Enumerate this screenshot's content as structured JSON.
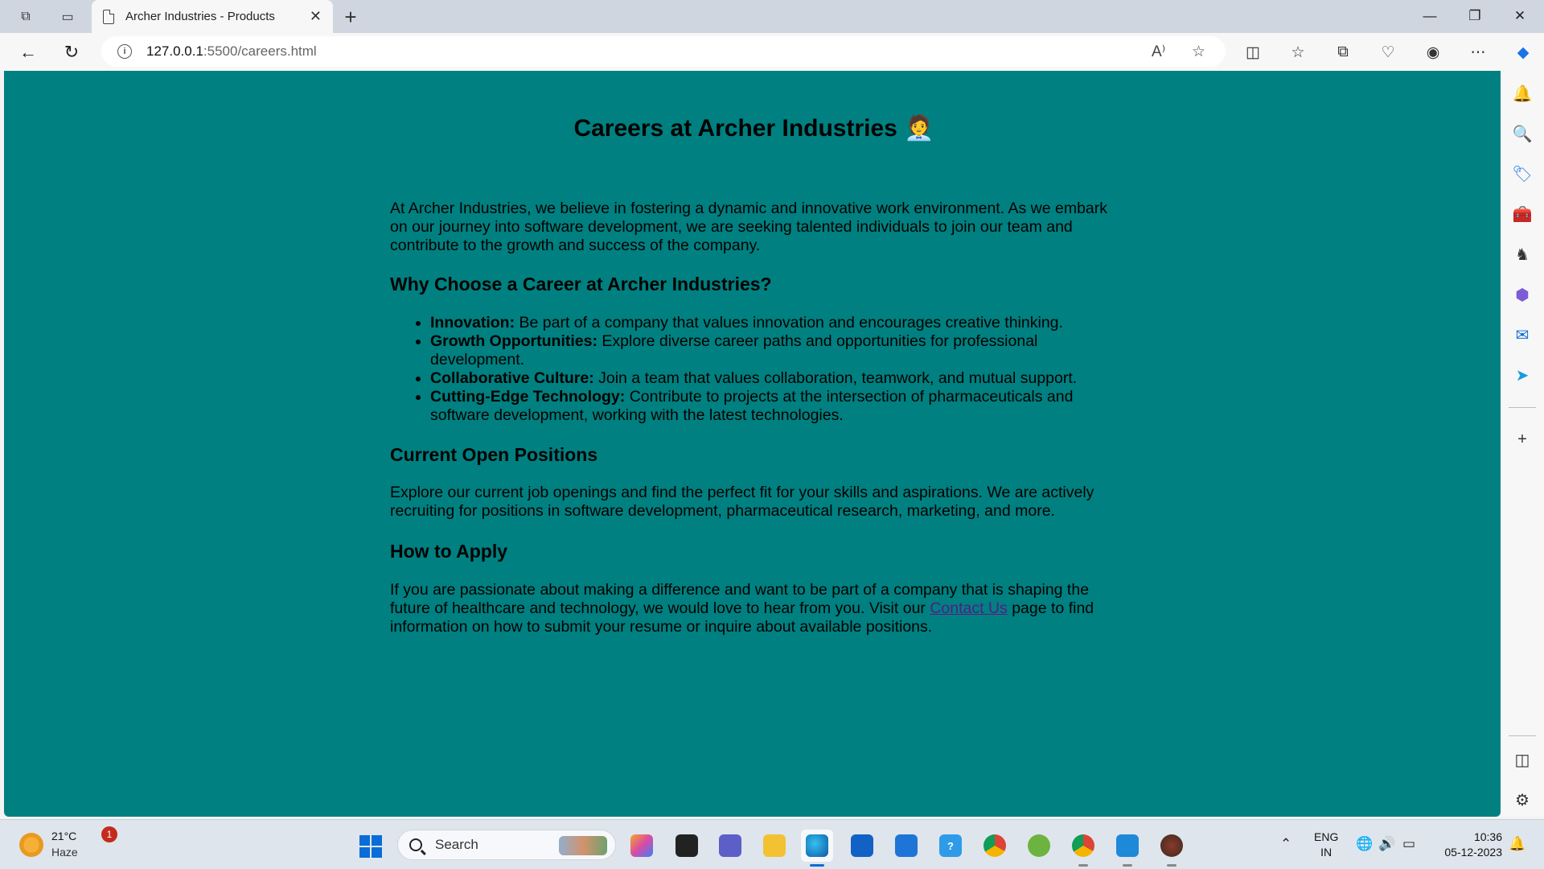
{
  "browser": {
    "tab_title": "Archer Industries - Products",
    "tab_close": "✕",
    "new_tab": "+",
    "address": {
      "host": "127.0.0.1",
      "path": ":5500/careers.html"
    },
    "window_controls": {
      "minimize": "—",
      "restore": "❐",
      "close": "✕"
    }
  },
  "page": {
    "background": "#008080",
    "title": "Careers at Archer Industries 🧑‍💼",
    "intro": "At Archer Industries, we believe in fostering a dynamic and innovative work environment. As we embark on our journey into software development, we are seeking talented individuals to join our team and contribute to the growth and success of the company.",
    "why_heading": "Why Choose a Career at Archer Industries?",
    "perks": [
      {
        "label": "Innovation:",
        "text": " Be part of a company that values innovation and encourages creative thinking."
      },
      {
        "label": "Growth Opportunities:",
        "text": " Explore diverse career paths and opportunities for professional development."
      },
      {
        "label": "Collaborative Culture:",
        "text": " Join a team that values collaboration, teamwork, and mutual support."
      },
      {
        "label": "Cutting-Edge Technology:",
        "text": " Contribute to projects at the intersection of pharmaceuticals and software development, working with the latest technologies."
      }
    ],
    "positions_heading": "Current Open Positions",
    "positions_text": "Explore our current job openings and find the perfect fit for your skills and aspirations. We are actively recruiting for positions in software development, pharmaceutical research, marketing, and more.",
    "apply_heading": "How to Apply",
    "apply_text_before": "If you are passionate about making a difference and want to be part of a company that is shaping the future of healthcare and technology, we would love to hear from you. Visit our ",
    "apply_link": "Contact Us",
    "apply_text_after": " page to find information on how to submit your resume or inquire about available positions."
  },
  "taskbar": {
    "weather_temp": "21°C",
    "weather_desc": "Haze",
    "notification_count": "1",
    "search_label": "Search",
    "lang_line1": "ENG",
    "lang_line2": "IN",
    "time": "10:36",
    "date": "05-12-2023"
  }
}
